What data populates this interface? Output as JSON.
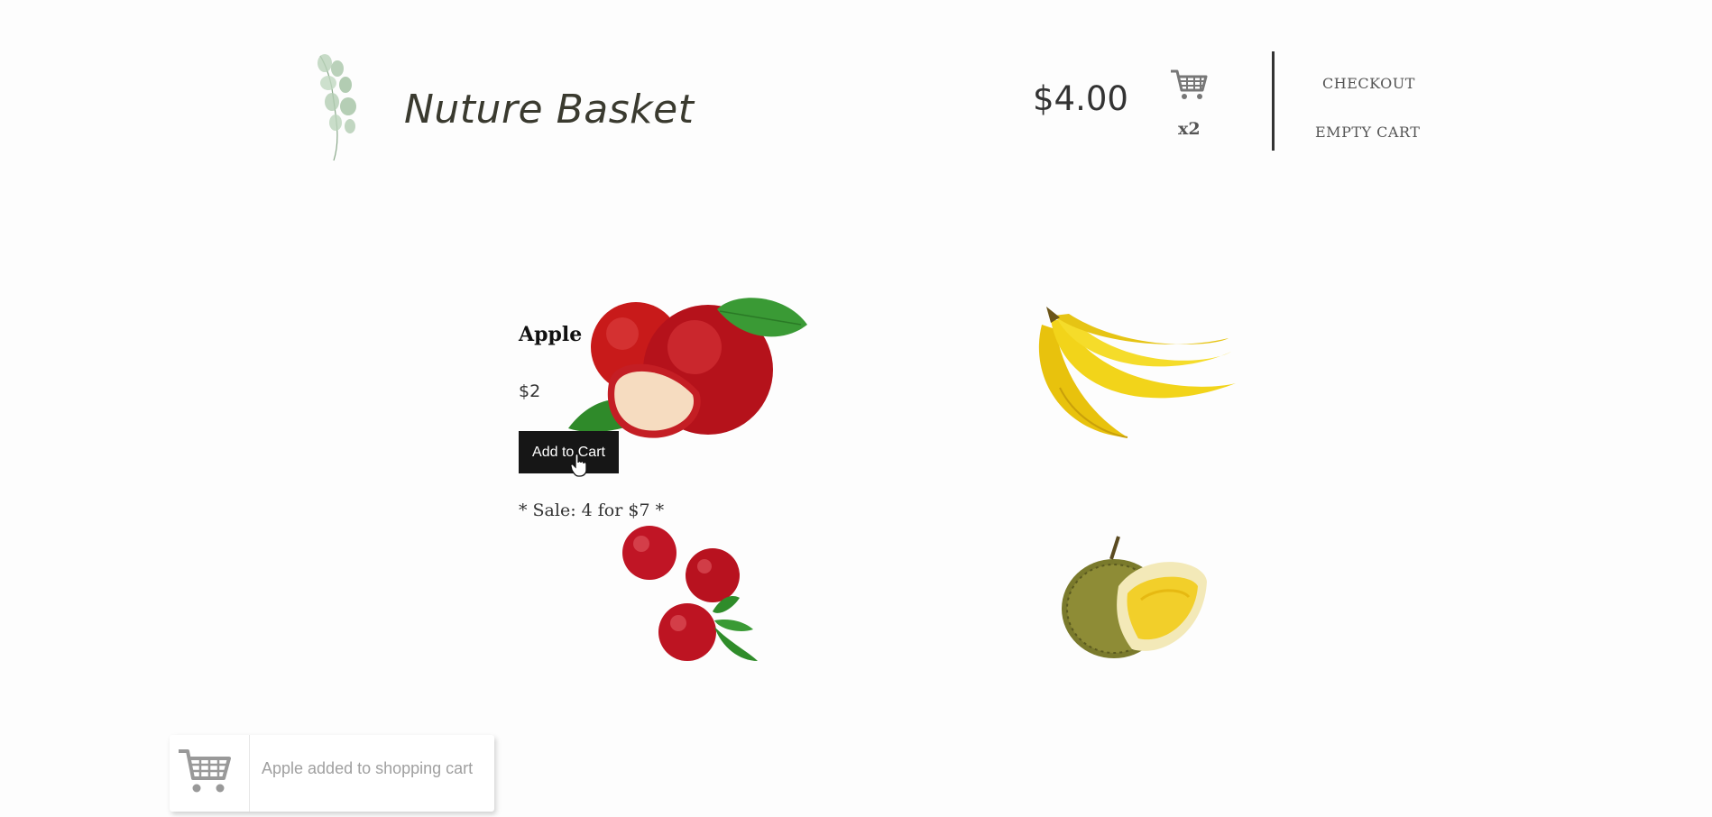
{
  "header": {
    "brand": "Nuture Basket",
    "cart_total": "$4.00",
    "cart_count": "x2",
    "checkout_label": "CHECKOUT",
    "empty_cart_label": "EMPTY CART"
  },
  "products": [
    {
      "name": "Apple",
      "price": "$2",
      "add_button": "Add to Cart",
      "sale": "* Sale: 4 for $7 *"
    }
  ],
  "toast": {
    "message": "Apple added to shopping cart"
  },
  "colors": {
    "button_bg": "#161616",
    "divider": "#333333",
    "toast_text": "#a0a0a0"
  }
}
